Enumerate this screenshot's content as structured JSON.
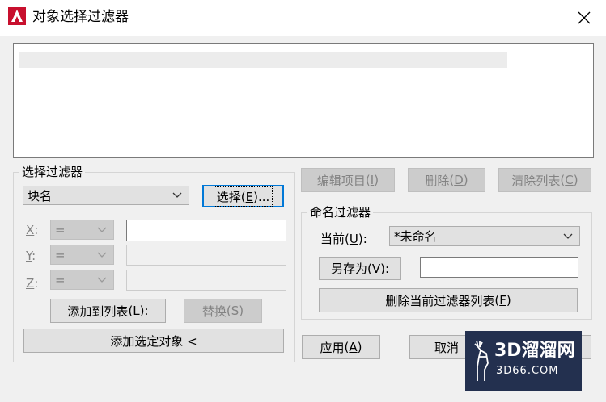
{
  "window": {
    "title": "对象选择过滤器",
    "close_glyph": "✕"
  },
  "select_filter": {
    "group_title": "选择过滤器",
    "type_combo_value": "块名",
    "select_button": {
      "text": "选择",
      "hot": "E",
      "suffix": "..."
    },
    "x_label": {
      "hot": "X",
      "rest": ":"
    },
    "y_label": {
      "hot": "Y",
      "rest": ":"
    },
    "z_label": {
      "hot": "Z",
      "rest": ":"
    },
    "op_value": "=",
    "add_to_list_button": {
      "text": "添加到列表",
      "hot": "L",
      "suffix": ":"
    },
    "replace_button": {
      "text": "替换",
      "hot": "S"
    },
    "add_selected_button": "添加选定对象 <"
  },
  "list_actions": {
    "edit_item": {
      "text": "编辑项目",
      "hot": "I"
    },
    "delete": {
      "text": "删除",
      "hot": "D"
    },
    "clear_list": {
      "text": "清除列表",
      "hot": "C"
    }
  },
  "named_filter": {
    "group_title": "命名过滤器",
    "current_label": {
      "text": "当前",
      "hot": "U",
      "suffix": ":"
    },
    "current_value": "*未命名",
    "save_as_button": {
      "text": "另存为",
      "hot": "V",
      "suffix": ":"
    },
    "save_as_value": "",
    "delete_current_button": {
      "text": "删除当前过滤器列表",
      "hot": "F"
    }
  },
  "footer": {
    "apply": {
      "text": "应用",
      "hot": "A"
    },
    "cancel": "取消"
  },
  "watermark": {
    "title": "3D溜溜网",
    "url": "3D66.COM"
  }
}
